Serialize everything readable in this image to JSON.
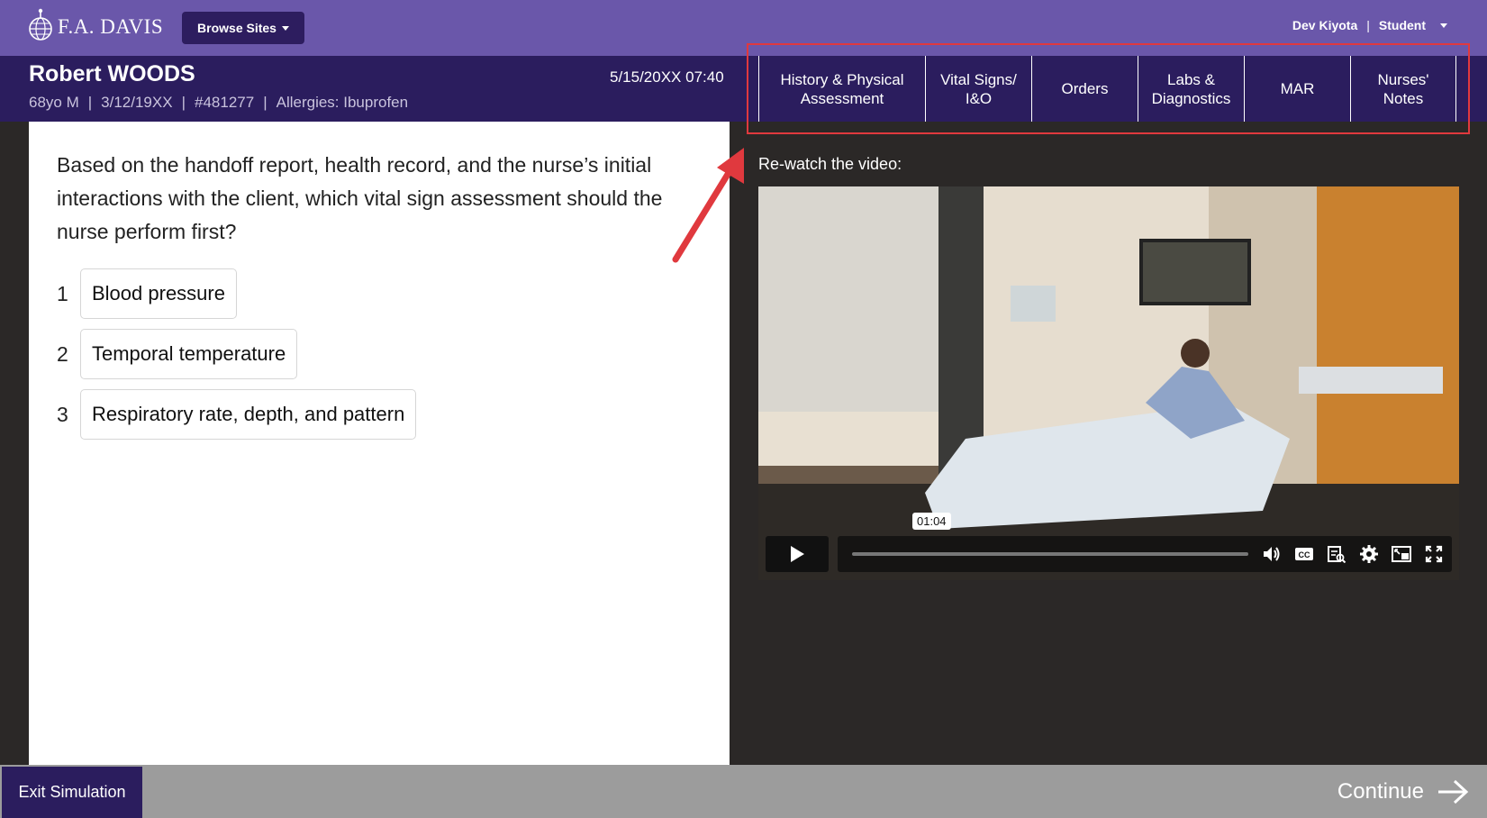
{
  "header": {
    "logo_text": "F.A. DAVIS",
    "browse_label": "Browse Sites",
    "user_name": "Dev Kiyota",
    "user_sep": "|",
    "user_role": "Student"
  },
  "patient": {
    "name": "Robert WOODS",
    "age_sex": "68yo M",
    "dob": "3/12/19XX",
    "mrn": "#481277",
    "allergies": "Allergies: Ibuprofen",
    "sep": "|",
    "datetime": "5/15/20XX 07:40"
  },
  "tabs": [
    {
      "label_line1": "History & Physical",
      "label_line2": "Assessment"
    },
    {
      "label_line1": "Vital Signs/",
      "label_line2": "I&O"
    },
    {
      "label_line1": "Orders",
      "label_line2": ""
    },
    {
      "label_line1": "Labs &",
      "label_line2": "Diagnostics"
    },
    {
      "label_line1": "MAR",
      "label_line2": ""
    },
    {
      "label_line1": "Nurses'",
      "label_line2": "Notes"
    }
  ],
  "question": {
    "text": "Based on the handoff report, health record, and the nurse’s initial interactions with the client, which vital sign assessment should the nurse perform first?",
    "options": [
      {
        "num": "1",
        "label": "Blood pressure"
      },
      {
        "num": "2",
        "label": "Temporal temperature"
      },
      {
        "num": "3",
        "label": "Respiratory rate, depth, and pattern"
      }
    ]
  },
  "video": {
    "rewatch_label": "Re-watch the video:",
    "time_tooltip": "01:04",
    "icons": [
      "play-icon",
      "volume-icon",
      "closed-captions-icon",
      "transcript-icon",
      "settings-icon",
      "picture-in-picture-icon",
      "fullscreen-icon"
    ]
  },
  "footer": {
    "exit_label": "Exit Simulation",
    "continue_label": "Continue"
  },
  "colors": {
    "topbar": "#6a57aa",
    "patientbar": "#2b1d5e",
    "highlight": "#e0393e",
    "footer": "#9c9c9c"
  }
}
